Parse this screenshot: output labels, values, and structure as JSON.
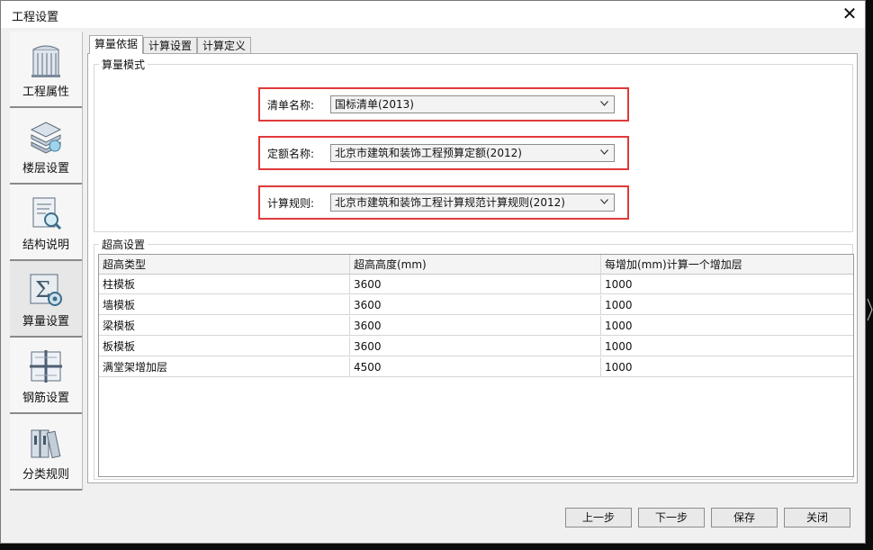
{
  "window": {
    "title": "工程设置",
    "close": "✕"
  },
  "sidebar": {
    "items": [
      {
        "label": "工程属性",
        "icon": "building-icon"
      },
      {
        "label": "楼层设置",
        "icon": "floor-layers-icon"
      },
      {
        "label": "结构说明",
        "icon": "document-magnifier-icon"
      },
      {
        "label": "算量设置",
        "icon": "sigma-gear-icon"
      },
      {
        "label": "钢筋设置",
        "icon": "rebar-icon"
      },
      {
        "label": "分类规则",
        "icon": "books-icon"
      }
    ]
  },
  "tabs": [
    "算量依据",
    "计算设置",
    "计算定义"
  ],
  "calc_mode": {
    "title": "算量模式",
    "fields": [
      {
        "label": "清单名称:",
        "value": "国标清单(2013)"
      },
      {
        "label": "定额名称:",
        "value": "北京市建筑和装饰工程预算定额(2012)"
      },
      {
        "label": "计算规则:",
        "value": "北京市建筑和装饰工程计算规范计算规则(2012)"
      }
    ]
  },
  "overheight": {
    "title": "超高设置",
    "columns": [
      "超高类型",
      "超高高度(mm)",
      "每增加(mm)计算一个增加层"
    ],
    "rows": [
      [
        "柱模板",
        "3600",
        "1000"
      ],
      [
        "墙模板",
        "3600",
        "1000"
      ],
      [
        "梁模板",
        "3600",
        "1000"
      ],
      [
        "板模板",
        "3600",
        "1000"
      ],
      [
        "满堂架增加层",
        "4500",
        "1000"
      ]
    ]
  },
  "footer": {
    "prev": "上一步",
    "next": "下一步",
    "save": "保存",
    "close": "关闭"
  }
}
